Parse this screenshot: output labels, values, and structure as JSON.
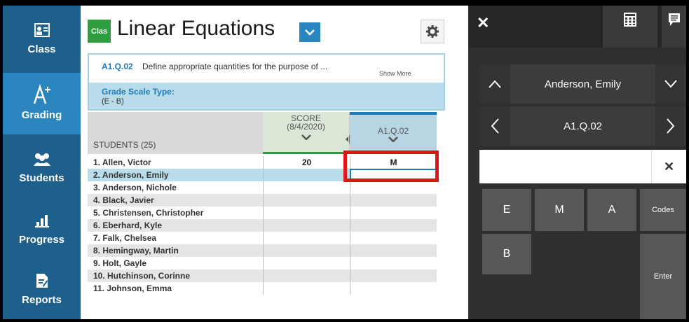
{
  "sidebar": {
    "items": [
      {
        "label": "Class",
        "icon": "class-icon",
        "active": false
      },
      {
        "label": "Grading",
        "icon": "grading-icon",
        "active": true
      },
      {
        "label": "Students",
        "icon": "students-icon",
        "active": false
      },
      {
        "label": "Progress",
        "icon": "progress-icon",
        "active": false
      },
      {
        "label": "Reports",
        "icon": "reports-icon",
        "active": false
      }
    ]
  },
  "header": {
    "class_badge": "Clas",
    "title": "Linear Equations"
  },
  "standard": {
    "code": "A1.Q.02",
    "description": "Define appropriate quantities for the purpose of ...",
    "show_more": "Show More",
    "grade_scale_label": "Grade Scale Type:",
    "grade_scale_value": "(E - B)"
  },
  "grid": {
    "students_header": "STUDENTS (25)",
    "score_header_line1": "SCORE",
    "score_header_line2": "(8/4/2020)",
    "standard_header": "A1.Q.02",
    "rows": [
      {
        "name": "1. Allen, Victor",
        "score": "20",
        "standard": "M"
      },
      {
        "name": "2. Anderson, Emily",
        "score": "",
        "standard": ""
      },
      {
        "name": "3. Anderson, Nichole",
        "score": "",
        "standard": ""
      },
      {
        "name": "4. Black, Javier",
        "score": "",
        "standard": ""
      },
      {
        "name": "5. Christensen, Christopher",
        "score": "",
        "standard": ""
      },
      {
        "name": "6. Eberhard, Kyle",
        "score": "",
        "standard": ""
      },
      {
        "name": "7. Falk, Chelsea",
        "score": "",
        "standard": ""
      },
      {
        "name": "8. Hemingway, Martin",
        "score": "",
        "standard": ""
      },
      {
        "name": "9. Holt, Gayle",
        "score": "",
        "standard": ""
      },
      {
        "name": "10. Hutchinson, Corinne",
        "score": "",
        "standard": ""
      },
      {
        "name": "11. Johnson, Emma",
        "score": "",
        "standard": ""
      }
    ]
  },
  "panel": {
    "student_name": "Anderson, Emily",
    "assignment": "A1.Q.02",
    "entry_value": "",
    "keys": {
      "e": "E",
      "m": "M",
      "a": "A",
      "codes": "Codes",
      "b": "B",
      "enter": "Enter"
    }
  },
  "colors": {
    "sidebar": "#1e5f8c",
    "sidebar_active": "#2b86bf",
    "highlight": "#e01515",
    "panel": "#2f2f2f"
  }
}
